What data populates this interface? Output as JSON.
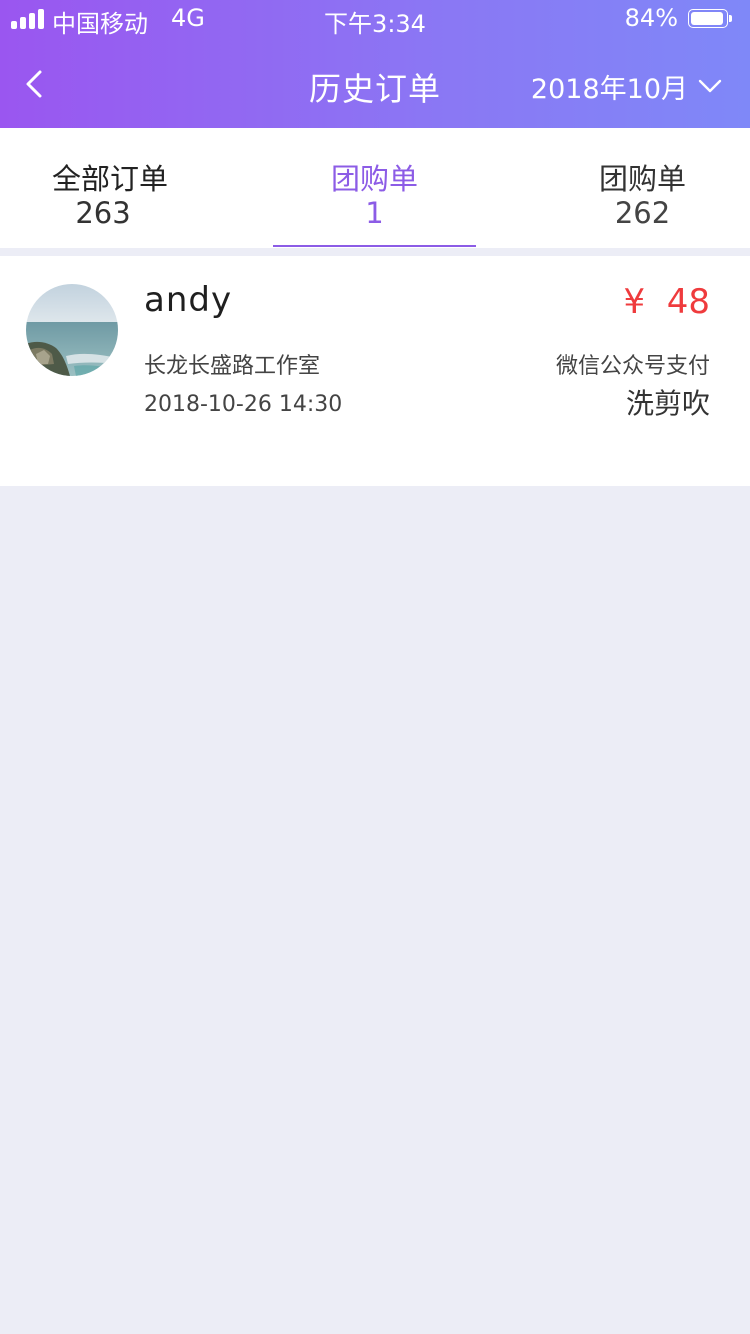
{
  "status_bar": {
    "carrier": "中国移动",
    "network": "4G",
    "time": "下午3:34",
    "battery": "84%",
    "battery_level": 0.84
  },
  "nav": {
    "title": "历史订单",
    "month": "2018年10月",
    "back_icon": "chevron-left-icon",
    "month_icon": "chevron-down-icon"
  },
  "tabs": [
    {
      "label": "全部订单",
      "count": "263",
      "active": false
    },
    {
      "label": "团购单",
      "count": "1",
      "active": true
    },
    {
      "label": "团购单",
      "count": "262",
      "active": false
    }
  ],
  "orders": [
    {
      "customer": "andy",
      "store": "长龙长盛路工作室",
      "time": "2018-10-26 14:30",
      "price": "¥  48",
      "payment": "微信公众号支付",
      "service": "洗剪吹"
    }
  ],
  "colors": {
    "header_start": "#9a56f0",
    "header_end": "#7f88f8",
    "accent": "#8c5ce6",
    "price": "#ef3b3d",
    "background": "#ecedf6"
  }
}
